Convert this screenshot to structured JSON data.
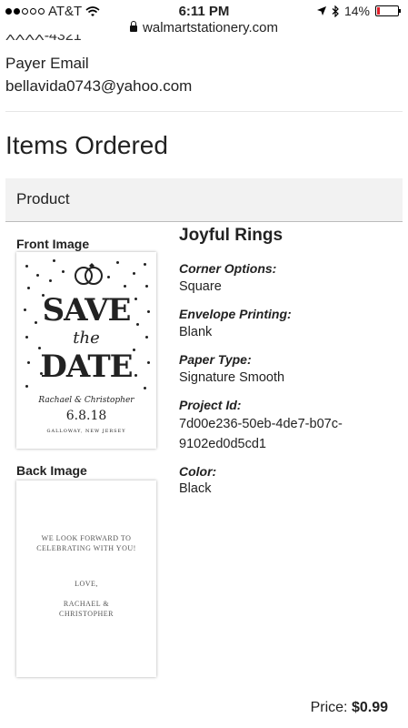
{
  "status_bar": {
    "carrier": "AT&T",
    "time": "6:11 PM",
    "battery": "14%",
    "battery_level": 0.14
  },
  "url_bar": {
    "domain": "walmartstationery.com"
  },
  "payer": {
    "clipped_text": "XXXX-4321",
    "email_label": "Payer Email",
    "email_value": "bellavida0743@yahoo.com"
  },
  "items_heading": "Items Ordered",
  "product_header": "Product",
  "product": {
    "front_label": "Front Image",
    "back_label": "Back Image",
    "front_card": {
      "line1": "SAVE",
      "line2": "the",
      "line3": "DATE",
      "names": "Rachael & Christopher",
      "date": "6.8.18",
      "place": "GALLOWAY, NEW JERSEY"
    },
    "back_card": {
      "line1": "WE LOOK FORWARD TO",
      "line2": "CELEBRATING WITH YOU!",
      "love": "LOVE,",
      "name1": "RACHAEL &",
      "name2": "CHRISTOPHER"
    },
    "name": "Joyful Rings",
    "details": [
      {
        "label": "Corner Options:",
        "value": "Square"
      },
      {
        "label": "Envelope Printing:",
        "value": "Blank"
      },
      {
        "label": "Paper Type:",
        "value": "Signature Smooth"
      },
      {
        "label": "Project Id:",
        "value": "7d00e236-50eb-4de7-b07c-",
        "value2": "9102ed0d5cd1"
      },
      {
        "label": "Color:",
        "value": "Black"
      }
    ],
    "price_label": "Price:",
    "price_value": "$0.99"
  }
}
